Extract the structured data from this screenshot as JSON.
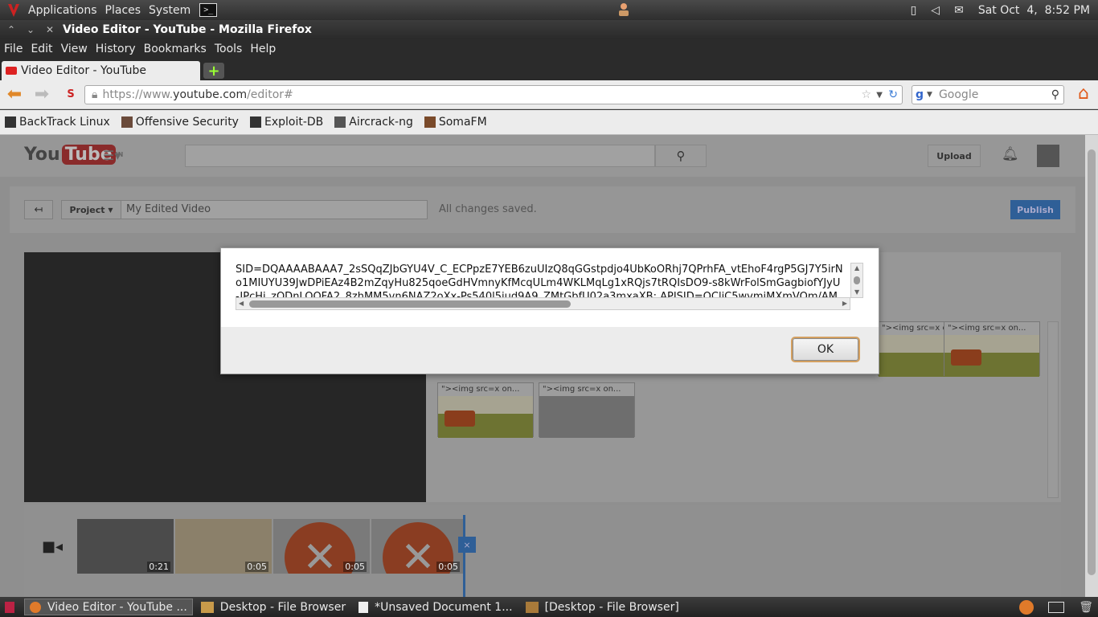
{
  "top_panel": {
    "menus": [
      "Applications",
      "Places",
      "System"
    ],
    "datetime": "Sat Oct  4,  8:52 PM"
  },
  "window": {
    "title": "Video Editor - YouTube - Mozilla Firefox"
  },
  "menubar": {
    "items": [
      "File",
      "Edit",
      "View",
      "History",
      "Bookmarks",
      "Tools",
      "Help"
    ]
  },
  "tabs": [
    {
      "label": "Video Editor - YouTube",
      "active": true
    }
  ],
  "navbar": {
    "url_prefix": "https://www.",
    "url_domain": "youtube.com",
    "url_path": "/editor#",
    "search_placeholder": "Google"
  },
  "bookmarks": [
    "BackTrack Linux",
    "Offensive Security",
    "Exploit-DB",
    "Aircrack-ng",
    "SomaFM"
  ],
  "youtube": {
    "logo_you": "You",
    "logo_tube": "Tube",
    "logo_suffix": "IN",
    "upload_label": "Upload",
    "project_label": "Project",
    "project_name": "My Edited Video",
    "save_status": "All changes saved.",
    "publish_label": "Publish",
    "clip_caption": "\"><img src=x on...",
    "timeline_clips": [
      {
        "duration": "0:21"
      },
      {
        "duration": "0:05"
      },
      {
        "duration": "0:05"
      },
      {
        "duration": "0:05"
      }
    ]
  },
  "alert": {
    "message_lines": [
      "SID=DQAAAABAAA7_2sSQqZJbGYU4V_C_ECPpzE7YEB6zuUIzQ8qGGstpdjo4UbKoORhj7QPrhFA_vtEhoF4rgP5GJ7Y5irN",
      "o1MIUYU39JwDPiEAz4B2mZqyHu825qoeGdHVmnyKfMcqULm4WKLMqLg1xRQjs7tRQIsDO9-s8kWrFolSmGagbiofYJyU",
      "-JPcHi_zODnLOOFA2_8zhMM5vn6NAZ2oXx-Ps540l5iud9A9_ZMtGbfU02a3mxaXB; APISID=OCliC5wvmiMXmVOm/AM"
    ],
    "ok_label": "OK"
  },
  "taskbar": {
    "tasks": [
      {
        "label": "Video Editor - YouTube ...",
        "active": true
      },
      {
        "label": "Desktop - File Browser",
        "active": false
      },
      {
        "label": "*Unsaved Document 1...",
        "active": false
      },
      {
        "label": "[Desktop - File Browser]",
        "active": false
      }
    ]
  },
  "colors": {
    "accent_publish": "#2f5f97",
    "firefox_home": "#e05a1a"
  }
}
